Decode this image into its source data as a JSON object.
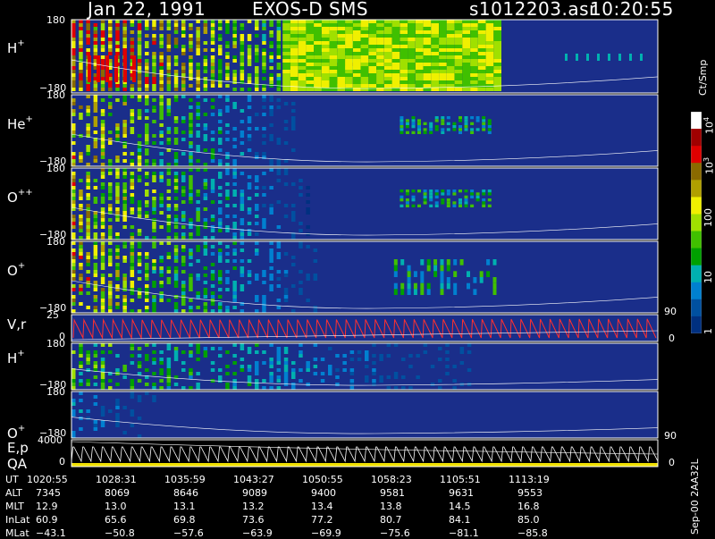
{
  "header": {
    "date": "Jan 22, 1991",
    "instrument": "EXOS-D SMS",
    "file": "s1012203.asr",
    "time": "10:20:55"
  },
  "panels": [
    {
      "label": "H",
      "sup": "+",
      "top_tick": "180",
      "bottom_tick": "-180",
      "pattern": "h1"
    },
    {
      "label": "He",
      "sup": "+",
      "top_tick": "180",
      "bottom_tick": "-180",
      "pattern": "he"
    },
    {
      "label": "O",
      "sup": "++",
      "top_tick": "180",
      "bottom_tick": "-180",
      "pattern": "opp"
    },
    {
      "label": "O",
      "sup": "+",
      "top_tick": "180",
      "bottom_tick": "-180",
      "pattern": "op1"
    },
    {
      "label": "V,r",
      "sup": "",
      "top_tick": "25",
      "bottom_tick": "0",
      "pattern": "vr"
    },
    {
      "label": "H",
      "sup": "+",
      "top_tick": "180",
      "bottom_tick": "-180",
      "pattern": "h2"
    },
    {
      "label": "O",
      "sup": "+",
      "top_tick": "180",
      "bottom_tick": "-180",
      "pattern": "op2"
    },
    {
      "label": "E,p",
      "label2": "QA",
      "sup": "",
      "top_tick": "4000",
      "bottom_tick": "0",
      "pattern": "ep"
    }
  ],
  "right_ticks": {
    "op1_top": "90",
    "op1_bot": "0",
    "op2_top": "90",
    "op2_bot": "0"
  },
  "colorbar": {
    "unit": "Ct/Smp",
    "labels": [
      "10",
      "10",
      "100",
      "10",
      "1"
    ],
    "sups": [
      "4",
      "3",
      "",
      "",
      ""
    ],
    "colors": [
      "#ffffff",
      "#a00000",
      "#e00000",
      "#8a6a00",
      "#b0a000",
      "#f0f000",
      "#a0e000",
      "#40c000",
      "#00a000",
      "#00b0b0",
      "#0080d0",
      "#0050a0",
      "#003080"
    ]
  },
  "footer": {
    "side_label": "Sep-00  2AA32L",
    "rows": [
      {
        "name": "UT",
        "values": [
          "1020:55",
          "1028:31",
          "1035:59",
          "1043:27",
          "1050:55",
          "1058:23",
          "1105:51",
          "1113:19"
        ]
      },
      {
        "name": "ALT",
        "values": [
          "7345",
          "8069",
          "8646",
          "9089",
          "9400",
          "9581",
          "9631",
          "9553"
        ]
      },
      {
        "name": "MLT",
        "values": [
          "12.9",
          "13.0",
          "13.1",
          "13.2",
          "13.4",
          "13.8",
          "14.5",
          "16.8"
        ]
      },
      {
        "name": "InLat",
        "values": [
          "60.9",
          "65.6",
          "69.8",
          "73.6",
          "77.2",
          "80.7",
          "84.1",
          "85.0"
        ]
      },
      {
        "name": "MLat",
        "values": [
          "-43.1",
          "-50.8",
          "-57.6",
          "-63.9",
          "-69.9",
          "-75.6",
          "-81.1",
          "-85.8"
        ]
      }
    ]
  },
  "chart_data": {
    "type": "heatmap",
    "title": "Jan 22, 1991   EXOS-D SMS",
    "x_ticks": [
      "1020:55",
      "1028:31",
      "1035:59",
      "1043:27",
      "1050:55",
      "1058:23",
      "1105:51",
      "1113:19"
    ],
    "series": [
      {
        "name": "H+",
        "ylim": [
          -180,
          180
        ]
      },
      {
        "name": "He+",
        "ylim": [
          -180,
          180
        ]
      },
      {
        "name": "O++",
        "ylim": [
          -180,
          180
        ]
      },
      {
        "name": "O+",
        "ylim": [
          -180,
          180
        ]
      },
      {
        "name": "V,r",
        "ylim": [
          0,
          25
        ]
      },
      {
        "name": "H+",
        "ylim": [
          -180,
          180
        ]
      },
      {
        "name": "O+",
        "ylim": [
          -180,
          180
        ]
      },
      {
        "name": "E,p",
        "ylim": [
          0,
          4000
        ]
      }
    ],
    "colorbar_unit": "Ct/Smp",
    "colorbar_ticks": [
      "10^4",
      "10^3",
      "100",
      "10",
      "1"
    ]
  }
}
